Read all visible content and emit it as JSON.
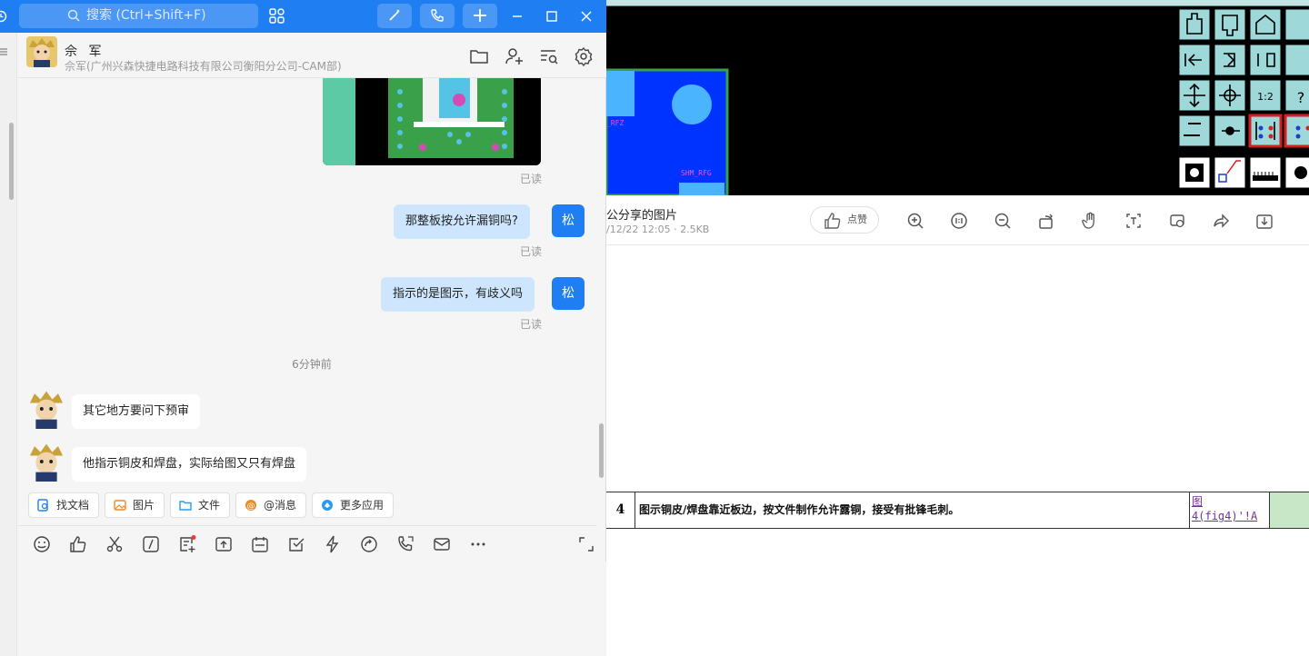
{
  "titlebar": {
    "search_placeholder": "搜索 (Ctrl+Shift+F)",
    "colors": {
      "bar": "#1e7ef2",
      "button": "#4a97f5"
    }
  },
  "chat": {
    "contact_name": "佘 军",
    "contact_sub": "佘军(广州兴森快捷电路科技有限公司衡阳分公司-CAM部)",
    "my_avatar_label": "松",
    "messages": [
      {
        "from": "me",
        "text": "那整板按允许漏铜吗?",
        "status": "已读"
      },
      {
        "from": "me",
        "text": "指示的是图示，有歧义吗",
        "status": "已读"
      },
      {
        "from": "other",
        "text": "其它地方要问下预审"
      },
      {
        "from": "other",
        "text": "他指示铜皮和焊盘，实际给图又只有焊盘"
      }
    ],
    "image_status": "已读",
    "time_divider": "6分钟前",
    "quick_actions": [
      "找文档",
      "图片",
      "文件",
      "@消息",
      "更多应用"
    ]
  },
  "viewer": {
    "file_title": "公分享的图片",
    "file_meta": "/12/22 12:05 · 2.5KB",
    "like_label": "点赞"
  },
  "cad": {
    "labels": [
      "SHM_RFG",
      "_RFZ"
    ]
  },
  "sheet": {
    "row_number": "4",
    "row_text": "图示铜皮/焊盘靠近板边，按文件制作允许露铜，接受有批锋毛刺。",
    "link_line1": "图",
    "link_line2": "4(fig4)'!A"
  }
}
